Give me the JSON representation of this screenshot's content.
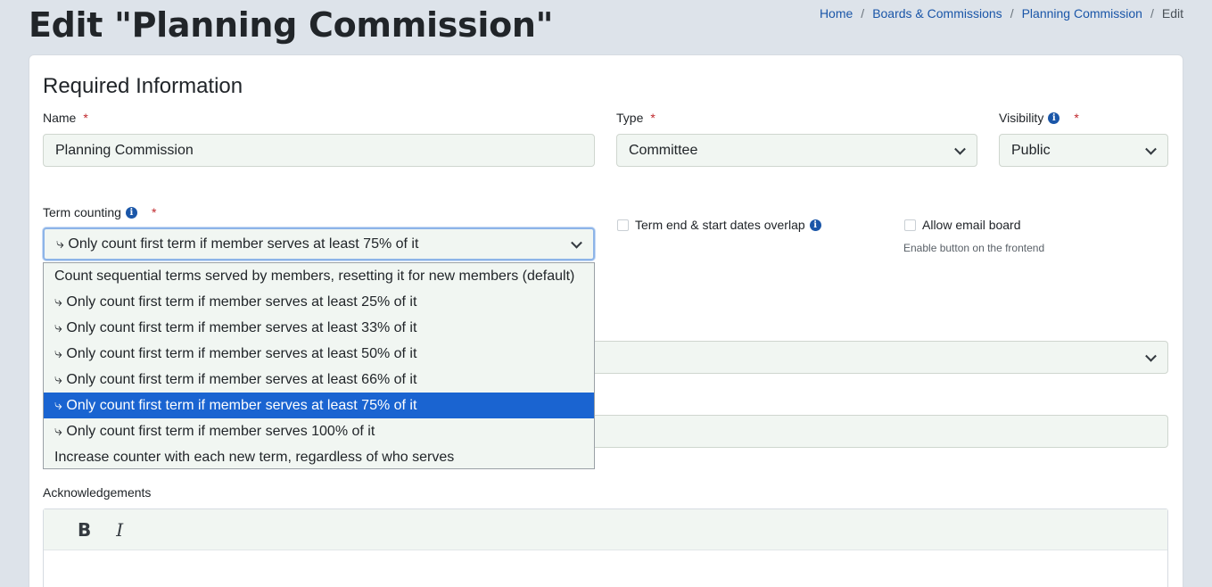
{
  "header": {
    "title": "Edit \"Planning Commission\"",
    "breadcrumb": [
      "Home",
      "Boards & Commissions",
      "Planning Commission",
      "Edit"
    ]
  },
  "form": {
    "section_title": "Required Information",
    "name": {
      "label": "Name",
      "value": "Planning Commission"
    },
    "type": {
      "label": "Type",
      "value": "Committee"
    },
    "visibility": {
      "label": "Visibility",
      "value": "Public"
    },
    "term_counting": {
      "label": "Term counting",
      "value": "⤷ Only count first term if member serves at least 75% of it",
      "options": [
        "Count sequential terms served by members, resetting it for new members (default)",
        "⤷ Only count first term if member serves at least 25% of it",
        "⤷ Only count first term if member serves at least 33% of it",
        "⤷ Only count first term if member serves at least 50% of it",
        "⤷ Only count first term if member serves at least 66% of it",
        "⤷ Only count first term if member serves at least 75% of it",
        "⤷ Only count first term if member serves 100% of it",
        "Increase counter with each new term, regardless of who serves"
      ],
      "selected_index": 5
    },
    "overlap": {
      "label": "Term end & start dates overlap"
    },
    "allow_email": {
      "label": "Allow email board",
      "helper": "Enable button on the frontend"
    },
    "acknowledgements": {
      "label": "Acknowledgements",
      "bold": "B",
      "italic": "I"
    }
  },
  "icons": {
    "info": "info-circle-icon",
    "chevron": "chevron-down-icon"
  },
  "colors": {
    "accent": "#1a64d1",
    "link": "#1a56a8",
    "required": "#c0282d"
  }
}
